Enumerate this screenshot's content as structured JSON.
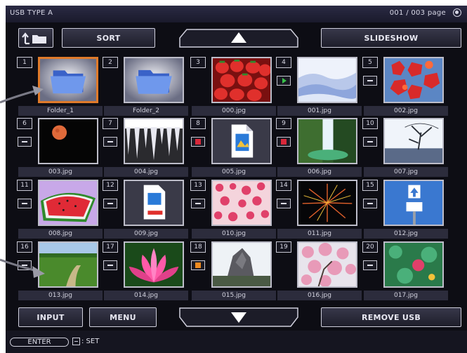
{
  "header": {
    "title": "USB TYPE A",
    "page_indicator": "001 / 003 page",
    "help_icon": "help-circle-icon"
  },
  "toolbar": {
    "up_folder_icon": "up-folder-icon",
    "sort_label": "SORT",
    "scroll_up_icon": "triangle-up-icon",
    "slideshow_label": "SLIDESHOW"
  },
  "footer_buttons": {
    "input_label": "INPUT",
    "menu_label": "MENU",
    "scroll_down_icon": "triangle-down-icon",
    "remove_usb_label": "REMOVE USB"
  },
  "status": {
    "enter_key": "ENTER",
    "set_label": ": SET"
  },
  "colors": {
    "selection": "#e07a2a",
    "background": "#0d0d14"
  },
  "grid": [
    {
      "num": "1",
      "name": "Folder_1",
      "kind": "folder",
      "selected": true
    },
    {
      "num": "2",
      "name": "Folder_2",
      "kind": "folder"
    },
    {
      "num": "3",
      "name": "000.jpg",
      "kind": "strawberries"
    },
    {
      "num": "4",
      "name": "001.jpg",
      "kind": "snow",
      "badge": "play"
    },
    {
      "num": "5",
      "name": "002.jpg",
      "kind": "maple",
      "badge": "tilde"
    },
    {
      "num": "6",
      "name": "003.jpg",
      "kind": "moon",
      "badge": "tilde"
    },
    {
      "num": "7",
      "name": "004.jpg",
      "kind": "icicles",
      "badge": "tilde"
    },
    {
      "num": "8",
      "name": "005.jpg",
      "kind": "fileicon",
      "badge": "error"
    },
    {
      "num": "9",
      "name": "006.jpg",
      "kind": "waterfall",
      "badge": "error"
    },
    {
      "num": "10",
      "name": "007.jpg",
      "kind": "tree",
      "badge": "tilde"
    },
    {
      "num": "11",
      "name": "008.jpg",
      "kind": "watermelon",
      "badge": "tilde"
    },
    {
      "num": "12",
      "name": "009.jpg",
      "kind": "jpgicon",
      "badge": "tilde"
    },
    {
      "num": "13",
      "name": "010.jpg",
      "kind": "blossom",
      "badge": "tilde"
    },
    {
      "num": "14",
      "name": "011.jpg",
      "kind": "fireworks",
      "badge": "tilde"
    },
    {
      "num": "15",
      "name": "012.jpg",
      "kind": "roadsign",
      "badge": "tilde"
    },
    {
      "num": "16",
      "name": "013.jpg",
      "kind": "path",
      "badge": "tilde"
    },
    {
      "num": "17",
      "name": "014.jpg",
      "kind": "lotus",
      "badge": "tilde"
    },
    {
      "num": "18",
      "name": "015.jpg",
      "kind": "rock",
      "badge": "orange"
    },
    {
      "num": "19",
      "name": "016.jpg",
      "kind": "sakura"
    },
    {
      "num": "20",
      "name": "017.jpg",
      "kind": "greenpink",
      "badge": "tilde"
    }
  ]
}
